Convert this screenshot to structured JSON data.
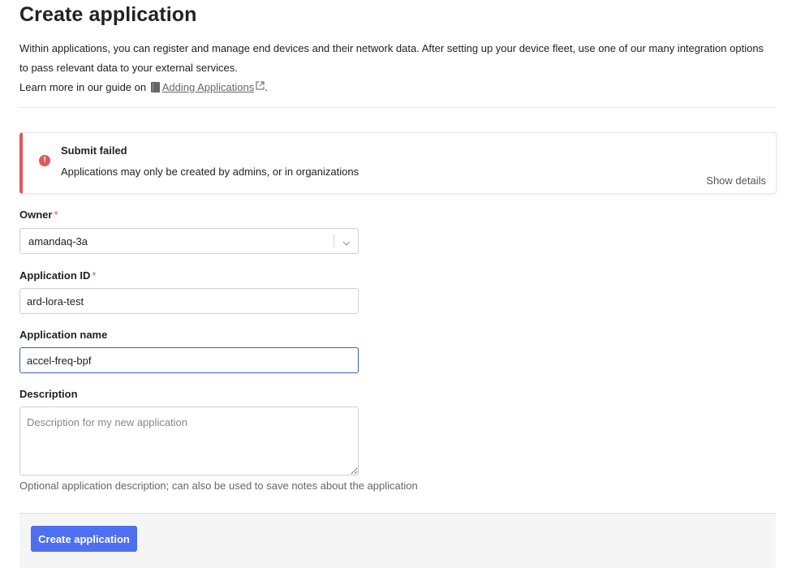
{
  "page": {
    "title": "Create application",
    "intro_line1": "Within applications, you can register and manage end devices and their network data. After setting up your device fleet, use one of our many integration options",
    "intro_line2": "to pass relevant data to your external services.",
    "guide_prefix": "Learn more in our guide on",
    "guide_link": "Adding Applications",
    "guide_suffix": "."
  },
  "alert": {
    "title": "Submit failed",
    "message": "Applications may only be created by admins, or in organizations",
    "details_label": "Show details",
    "color": "#e0575a"
  },
  "form": {
    "owner": {
      "label": "Owner",
      "required_mark": "*",
      "value": "amandaq-3a"
    },
    "app_id": {
      "label": "Application ID",
      "required_mark": "*",
      "value": "ard-lora-test"
    },
    "app_name": {
      "label": "Application name",
      "value": "accel-freq-bpf"
    },
    "description": {
      "label": "Description",
      "value": "",
      "placeholder": "Description for my new application",
      "hint": "Optional application description; can also be used to save notes about the application"
    },
    "submit_label": "Create application",
    "accent_color": "#4d6ff0"
  }
}
